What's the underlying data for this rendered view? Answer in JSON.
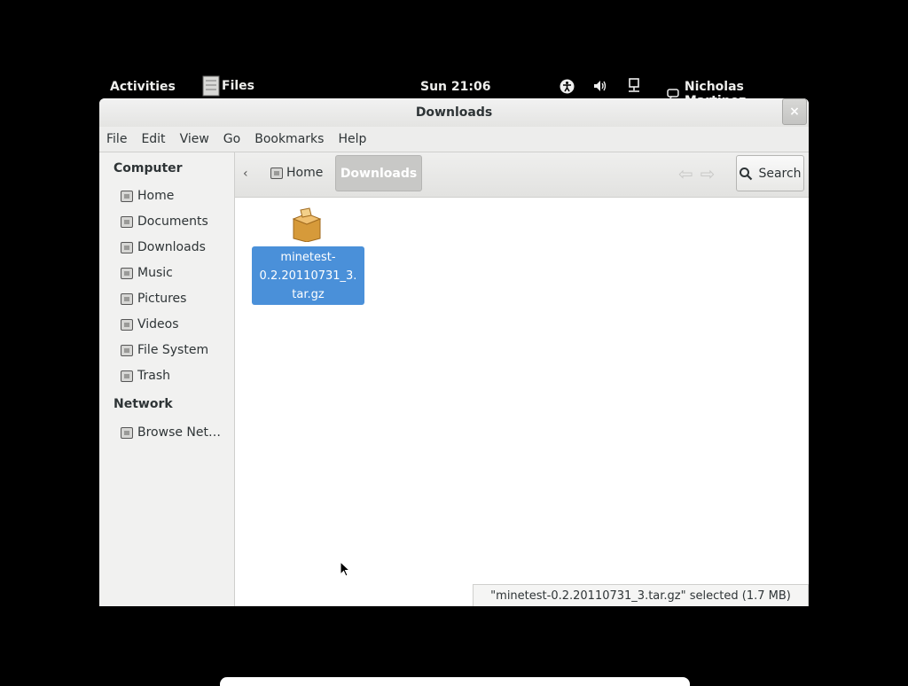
{
  "topbar": {
    "activities": "Activities",
    "app_name": "Files",
    "clock": "Sun 21:06",
    "user": "Nicholas Martinez",
    "tray_icons": [
      "accessibility-icon",
      "volume-icon",
      "network-icon"
    ]
  },
  "window": {
    "title": "Downloads",
    "close_glyph": "×"
  },
  "menubar": {
    "items": [
      "File",
      "Edit",
      "View",
      "Go",
      "Bookmarks",
      "Help"
    ]
  },
  "sidebar": {
    "computer_heading": "Computer",
    "computer_items": [
      "Home",
      "Documents",
      "Downloads",
      "Music",
      "Pictures",
      "Videos",
      "File System",
      "Trash"
    ],
    "network_heading": "Network",
    "network_items": [
      "Browse Net…"
    ]
  },
  "toolbar": {
    "back_glyph": "‹",
    "crumb_home": "Home",
    "crumb_current": "Downloads",
    "search_label": "Search"
  },
  "files": [
    {
      "name": "minetest-0.2.20110731_3.tar.gz",
      "lines": [
        "minetest-",
        "0.2.20110731_3.",
        "tar.gz"
      ],
      "selected": true,
      "icon": "package-archive-icon"
    }
  ],
  "status": {
    "text": "\"minetest-0.2.20110731_3.tar.gz\" selected (1.7 MB)"
  },
  "colors": {
    "selection": "#4a90d9",
    "background": "#000000"
  }
}
